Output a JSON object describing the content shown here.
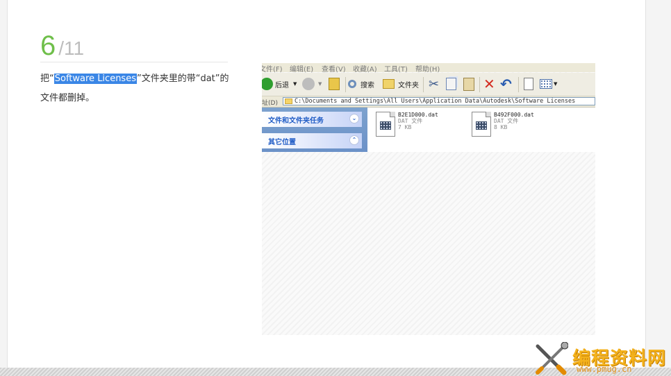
{
  "step": {
    "number": "6",
    "separator": "/",
    "total": "11"
  },
  "instruction": {
    "prefix": "把“",
    "highlight": "Software Licenses",
    "suffix_line1": "”文件夹里的带“dat”的",
    "line2": "文件都删掉。"
  },
  "explorer": {
    "menu": [
      "文件(F)",
      "编辑(E)",
      "查看(V)",
      "收藏(A)",
      "工具(T)",
      "帮助(H)"
    ],
    "toolbar": {
      "back_label": "后退",
      "search_label": "搜索",
      "folders_label": "文件夹"
    },
    "address": {
      "label": "址(D)",
      "path": "C:\\Documents and Settings\\All Users\\Application Data\\Autodesk\\Software Licenses"
    },
    "tasks": [
      {
        "label": "文件和文件夹任务"
      },
      {
        "label": "其它位置"
      }
    ],
    "files": [
      {
        "name": "B2E1D000.dat",
        "type": "DAT 文件",
        "size": "7 KB"
      },
      {
        "name": "B492F000.dat",
        "type": "DAT 文件",
        "size": "8 KB"
      }
    ]
  },
  "watermark": {
    "title": "编程资料网",
    "url": "www.pmug.cn"
  },
  "colors": {
    "step_number": "#6fbf4a",
    "step_total": "#bdbdbd",
    "highlight": "#3a86e6",
    "watermark": "#f4b21c"
  }
}
